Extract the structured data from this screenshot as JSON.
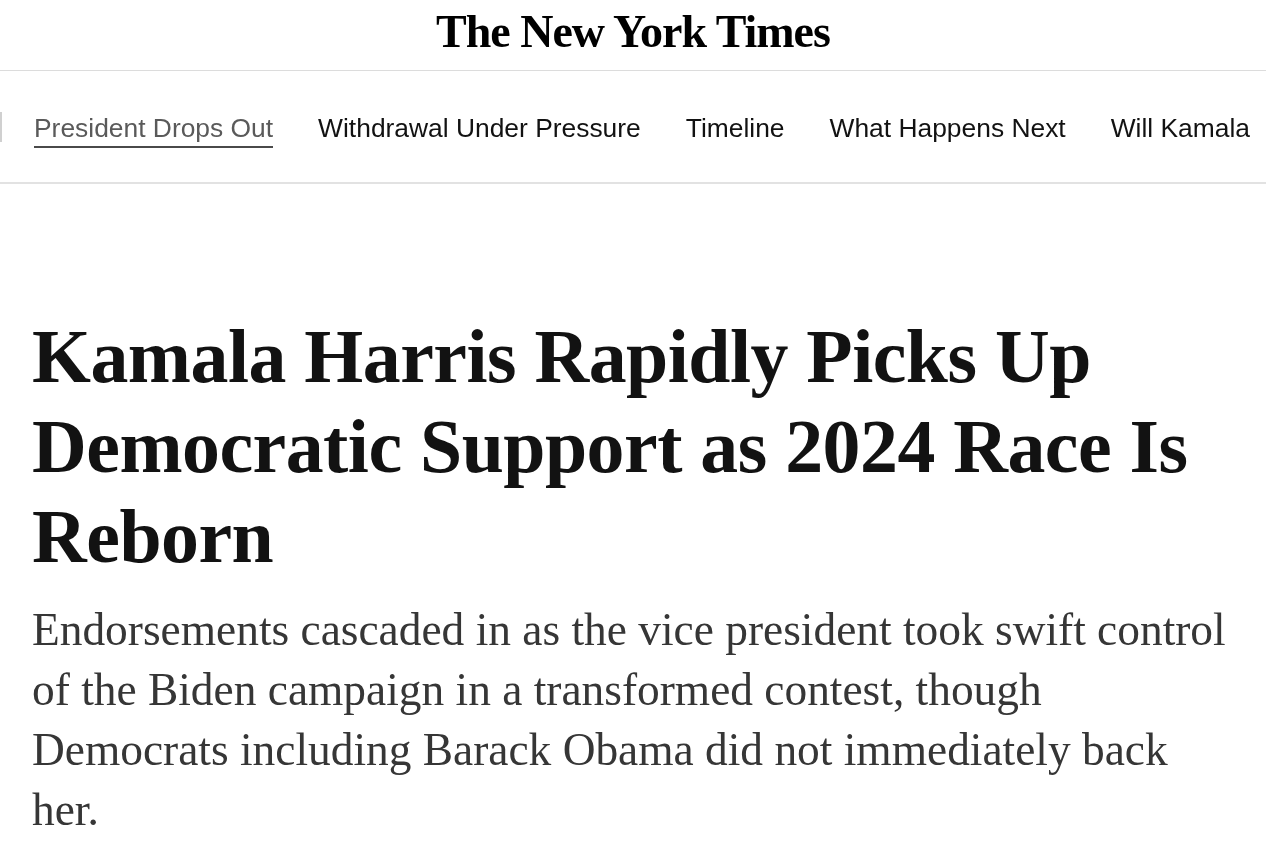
{
  "masthead": {
    "logo": "The New York Times"
  },
  "nav": {
    "tabs": [
      {
        "label": "President Drops Out",
        "selected": true
      },
      {
        "label": "Withdrawal Under Pressure",
        "selected": false
      },
      {
        "label": "Timeline",
        "selected": false
      },
      {
        "label": "What Happens Next",
        "selected": false
      },
      {
        "label": "Will Kamala",
        "selected": false
      }
    ]
  },
  "article": {
    "headline": "Kamala Harris Rapidly Picks Up Democratic Support as 2024 Race Is Reborn",
    "summary": "Endorsements cascaded in as the vice president took swift control of the Biden campaign in a transformed contest, though Democrats including Barack Obama did not immediately back her."
  }
}
